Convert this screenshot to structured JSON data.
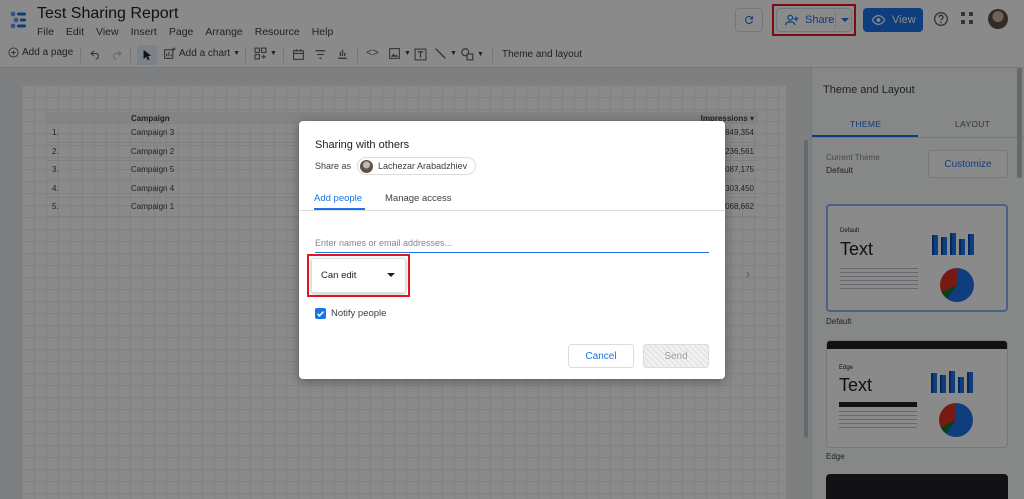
{
  "app": {
    "title": "Test Sharing Report",
    "menu": [
      "File",
      "Edit",
      "View",
      "Insert",
      "Page",
      "Arrange",
      "Resource",
      "Help"
    ],
    "share_label": "Share",
    "view_label": "View"
  },
  "toolbar": {
    "add_page": "Add a page",
    "add_chart": "Add a chart",
    "theme_layout": "Theme and layout"
  },
  "report_table": {
    "columns": [
      "Campaign",
      "Impressions ▾"
    ],
    "rows": [
      {
        "index": "1.",
        "campaign": "Campaign 3",
        "impressions": "849,354"
      },
      {
        "index": "2.",
        "campaign": "Campaign 2",
        "impressions": "236,561"
      },
      {
        "index": "3.",
        "campaign": "Campaign 5",
        "impressions": "087,175"
      },
      {
        "index": "4.",
        "campaign": "Campaign 4",
        "impressions": "303,450"
      },
      {
        "index": "5.",
        "campaign": "Campaign 1",
        "impressions": "068,662"
      }
    ],
    "pager_glyph": "›"
  },
  "panel": {
    "title": "Theme and Layout",
    "tabs": [
      "THEME",
      "LAYOUT"
    ],
    "current_theme_label": "Current Theme",
    "current_theme_value": "Default",
    "customize_label": "Customize",
    "themes": [
      {
        "card_label": "Default",
        "card_text": "Text",
        "name": "Default"
      },
      {
        "card_label": "Edge",
        "card_text": "Text",
        "name": "Edge"
      }
    ]
  },
  "dialog": {
    "title": "Sharing with others",
    "share_as_label": "Share as",
    "share_as_user": "Lachezar Arabadzhiev",
    "tabs": [
      "Add people",
      "Manage access"
    ],
    "email_placeholder": "Enter names or email addresses...",
    "permission_value": "Can edit",
    "notify_label": "Notify people",
    "notify_checked": true,
    "cancel_label": "Cancel",
    "send_label": "Send"
  },
  "colors": {
    "accent": "#1a73e8",
    "highlight": "#e0191f"
  }
}
